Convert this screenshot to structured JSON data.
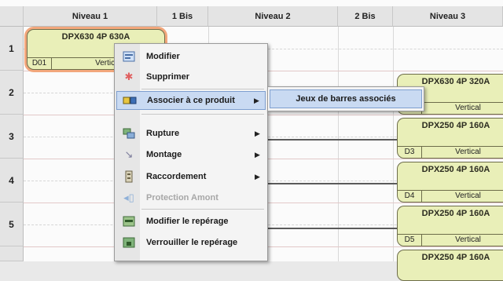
{
  "columns": [
    {
      "label": "Niveau 1"
    },
    {
      "label": "1 Bis"
    },
    {
      "label": "Niveau 2"
    },
    {
      "label": "2 Bis"
    },
    {
      "label": "Niveau 3"
    }
  ],
  "rows": [
    "1",
    "2",
    "3",
    "4",
    "5"
  ],
  "devices": [
    {
      "name": "DPX630 4P 630A",
      "tag": "D01",
      "orientation": "Vertical"
    },
    {
      "name": "DPX630 4P 320A",
      "tag": "",
      "orientation": "Vertical"
    },
    {
      "name": "DPX250 4P 160A",
      "tag": "D3",
      "orientation": "Vertical"
    },
    {
      "name": "DPX250 4P 160A",
      "tag": "D4",
      "orientation": "Vertical"
    },
    {
      "name": "DPX250 4P 160A",
      "tag": "D5",
      "orientation": "Vertical"
    },
    {
      "name": "DPX250 4P 160A",
      "tag": "",
      "orientation": ""
    }
  ],
  "context_menu": {
    "items": [
      {
        "label": "Modifier",
        "icon": "edit-icon"
      },
      {
        "label": "Supprimer",
        "icon": "delete-icon"
      },
      {
        "label": "Associer à ce produit",
        "icon": "associate-icon",
        "has_submenu": true,
        "highlighted": true
      },
      {
        "label": "Rupture",
        "icon": "rupture-icon",
        "has_submenu": true
      },
      {
        "label": "Montage",
        "icon": "mounting-icon",
        "has_submenu": true
      },
      {
        "label": "Raccordement",
        "icon": "connection-icon",
        "has_submenu": true
      },
      {
        "label": "Protection Amont",
        "icon": "protection-icon",
        "disabled": true
      },
      {
        "label": "Modifier le repérage",
        "icon": "edit-marking-icon"
      },
      {
        "label": "Verrouiller le repérage",
        "icon": "lock-marking-icon"
      }
    ]
  },
  "submenu": {
    "items": [
      {
        "label": "Jeux de barres associés"
      }
    ]
  }
}
